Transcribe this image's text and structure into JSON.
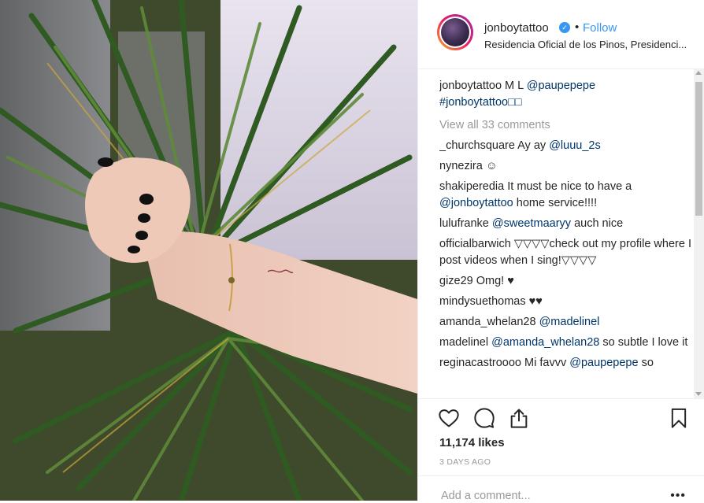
{
  "post": {
    "username": "jonboytattoo",
    "dot": "•",
    "follow_label": "Follow",
    "location": "Residencia Oficial de los Pinos, Presidenci...",
    "caption": {
      "author": "jonboytattoo",
      "text": " M L ",
      "mention": "@paupepepe",
      "hashtag": "#jonboytattoo□□"
    },
    "view_all": "View all 33 comments",
    "comments": [
      {
        "author": "_churchsquare",
        "text": " Ay ay ",
        "mention": "@luuu_2s",
        "after": ""
      },
      {
        "author": "nynezira",
        "text": " ☺",
        "mention": "",
        "after": ""
      },
      {
        "author": "shakiperedia",
        "text": " It must be nice to have a ",
        "mention": "@jonboytattoo",
        "after": " home service!!!!"
      },
      {
        "author": "lulufranke",
        "text": " ",
        "mention": "@sweetmaaryy",
        "after": " auch nice"
      },
      {
        "author": "officialbarwich",
        "text": " ▽▽▽▽check out my profile where I post videos when I sing!▽▽▽▽",
        "mention": "",
        "after": ""
      },
      {
        "author": "gize29",
        "text": " Omg! ♥",
        "mention": "",
        "after": ""
      },
      {
        "author": "mindysuethomas",
        "text": " ♥♥",
        "mention": "",
        "after": ""
      },
      {
        "author": "amanda_whelan28",
        "text": " ",
        "mention": "@madelinel",
        "after": ""
      },
      {
        "author": "madelinel",
        "text": " ",
        "mention": "@amanda_whelan28",
        "after": " so subtle I love it"
      },
      {
        "author": "reginacastroooo",
        "text": " Mi favvv ",
        "mention": "@paupepepe",
        "after": " so"
      }
    ],
    "likes": "11,174 likes",
    "time": "3 DAYS AGO",
    "add_comment_placeholder": "Add a comment...",
    "more": "•••"
  }
}
